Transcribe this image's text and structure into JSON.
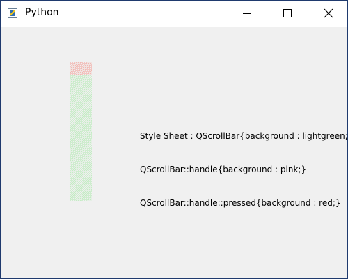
{
  "window": {
    "title": "Python",
    "icon": "python-icon",
    "controls": {
      "minimize_icon": "minimize-icon",
      "maximize_icon": "maximize-icon",
      "close_icon": "close-icon"
    }
  },
  "scrollbar": {
    "orientation": "vertical",
    "background_color": "#ccefcc",
    "handle_color": "#f3c7c2",
    "handle_position": 0
  },
  "label": {
    "lines": [
      "Style Sheet : QScrollBar{background : lightgreen;}",
      "QScrollBar::handle{background : pink;}",
      "QScrollBar::handle::pressed{background : red;}"
    ]
  }
}
